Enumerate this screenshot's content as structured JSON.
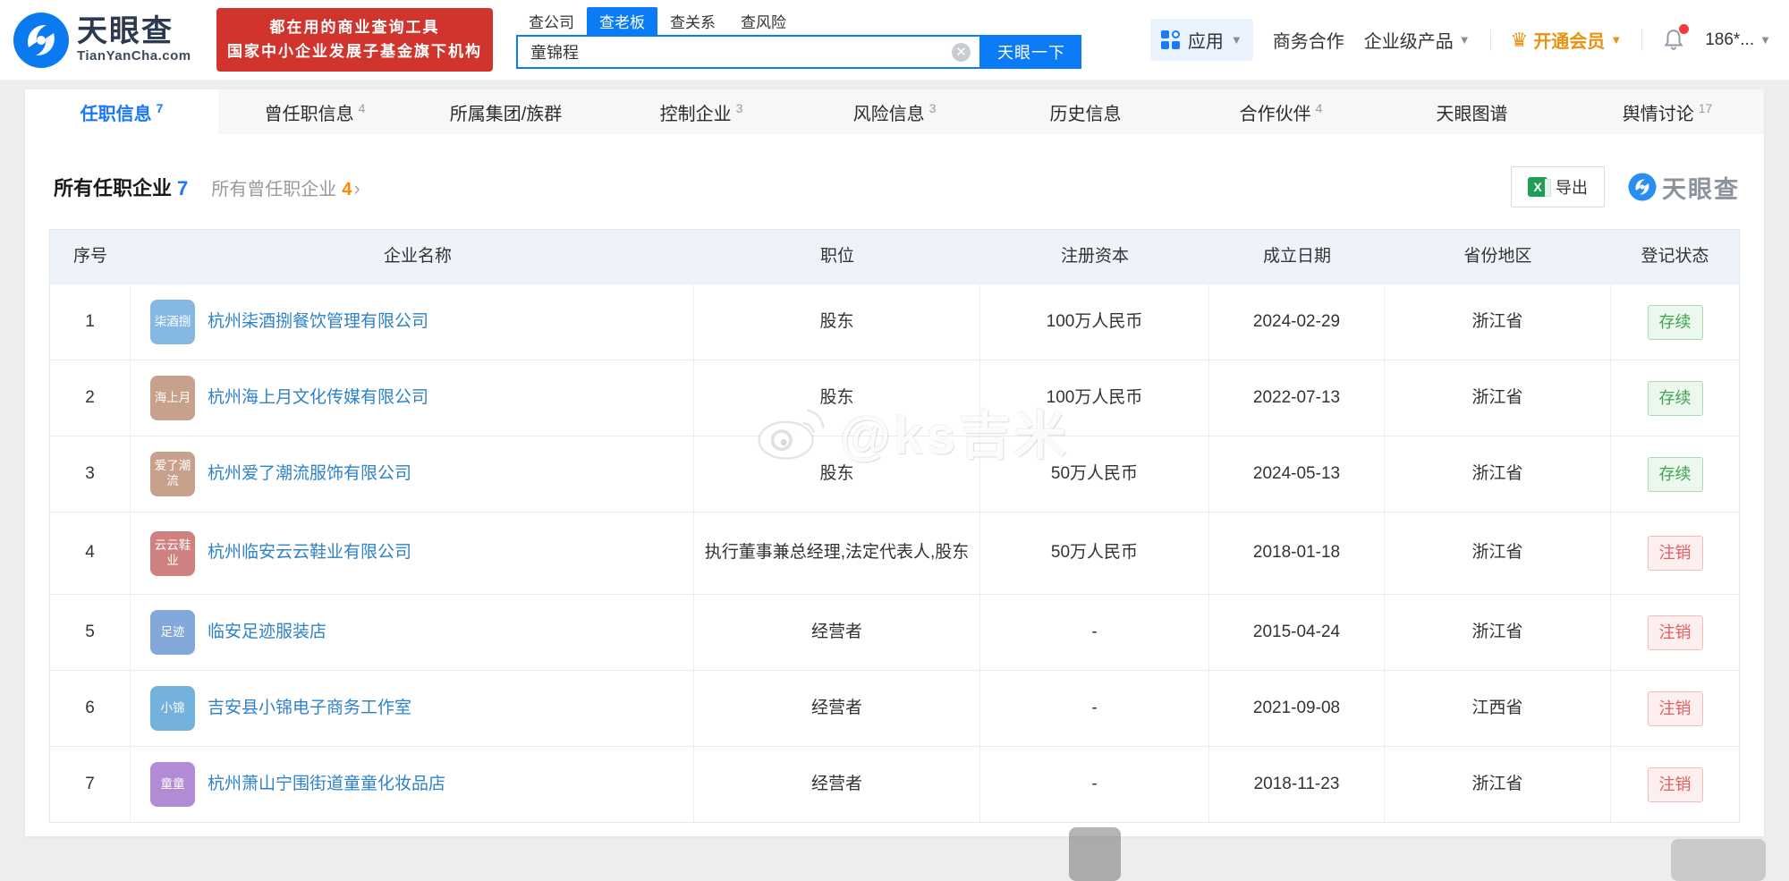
{
  "header": {
    "logo": {
      "title": "天眼查",
      "subtitle": "TianYanCha.com"
    },
    "promo": {
      "line1": "都在用的商业查询工具",
      "line2": "国家中小企业发展子基金旗下机构"
    },
    "search": {
      "tabs": [
        {
          "label": "查公司"
        },
        {
          "label": "查老板"
        },
        {
          "label": "查关系"
        },
        {
          "label": "查风险"
        }
      ],
      "value": "童锦程",
      "button": "天眼一下"
    },
    "nav": {
      "apps": "应用",
      "business": "商务合作",
      "enterprise": "企业级产品",
      "vip": "开通会员",
      "account": "186*..."
    }
  },
  "tabs": [
    {
      "label": "任职信息",
      "count": "7"
    },
    {
      "label": "曾任职信息",
      "count": "4"
    },
    {
      "label": "所属集团/族群",
      "count": ""
    },
    {
      "label": "控制企业",
      "count": "3"
    },
    {
      "label": "风险信息",
      "count": "3"
    },
    {
      "label": "历史信息",
      "count": ""
    },
    {
      "label": "合作伙伴",
      "count": "4"
    },
    {
      "label": "天眼图谱",
      "count": ""
    },
    {
      "label": "舆情讨论",
      "count": "17"
    }
  ],
  "section": {
    "title": "所有任职企业",
    "title_count": "7",
    "secondary": "所有曾任职企业",
    "secondary_count": "4",
    "chevron": "›",
    "export_label": "导出",
    "watermark_logo": "天眼查"
  },
  "table": {
    "columns": {
      "no": "序号",
      "company": "企业名称",
      "position": "职位",
      "capital": "注册资本",
      "date": "成立日期",
      "province": "省份地区",
      "status": "登记状态"
    },
    "rows": [
      {
        "no": "1",
        "avatar": "柒酒捌",
        "avatar_color": "#85b9e3",
        "company": "杭州柒酒捌餐饮管理有限公司",
        "position": "股东",
        "capital": "100万人民币",
        "date": "2024-02-29",
        "province": "浙江省",
        "status": "存续"
      },
      {
        "no": "2",
        "avatar": "海上月",
        "avatar_color": "#c8a18d",
        "company": "杭州海上月文化传媒有限公司",
        "position": "股东",
        "capital": "100万人民币",
        "date": "2022-07-13",
        "province": "浙江省",
        "status": "存续"
      },
      {
        "no": "3",
        "avatar": "爱了潮流",
        "avatar_color": "#c8a18d",
        "company": "杭州爱了潮流服饰有限公司",
        "position": "股东",
        "capital": "50万人民币",
        "date": "2024-05-13",
        "province": "浙江省",
        "status": "存续"
      },
      {
        "no": "4",
        "avatar": "云云鞋业",
        "avatar_color": "#cf8080",
        "company": "杭州临安云云鞋业有限公司",
        "position": "执行董事兼总经理,法定代表人,股东",
        "capital": "50万人民币",
        "date": "2018-01-18",
        "province": "浙江省",
        "status": "注销"
      },
      {
        "no": "5",
        "avatar": "足迹",
        "avatar_color": "#81a8d8",
        "company": "临安足迹服装店",
        "position": "经营者",
        "capital": "-",
        "date": "2015-04-24",
        "province": "浙江省",
        "status": "注销"
      },
      {
        "no": "6",
        "avatar": "小锦",
        "avatar_color": "#72b2dd",
        "company": "吉安县小锦电子商务工作室",
        "position": "经营者",
        "capital": "-",
        "date": "2021-09-08",
        "province": "江西省",
        "status": "注销"
      },
      {
        "no": "7",
        "avatar": "童童",
        "avatar_color": "#b18cd4",
        "company": "杭州萧山宁围街道童童化妆品店",
        "position": "经营者",
        "capital": "-",
        "date": "2018-11-23",
        "province": "浙江省",
        "status": "注销"
      }
    ]
  },
  "watermark_text": "@ks吉米",
  "colors": {
    "brand_blue": "#0b7cf5",
    "promo_red": "#d0342c",
    "vip_orange": "#e8920f",
    "link_blue": "#2e82c8",
    "active_tab_blue": "#1a75ff",
    "count_orange": "#ff8800",
    "status_green": "#3fa24e",
    "status_red": "#e25d5d",
    "table_header_bg": "#eef3f9"
  }
}
